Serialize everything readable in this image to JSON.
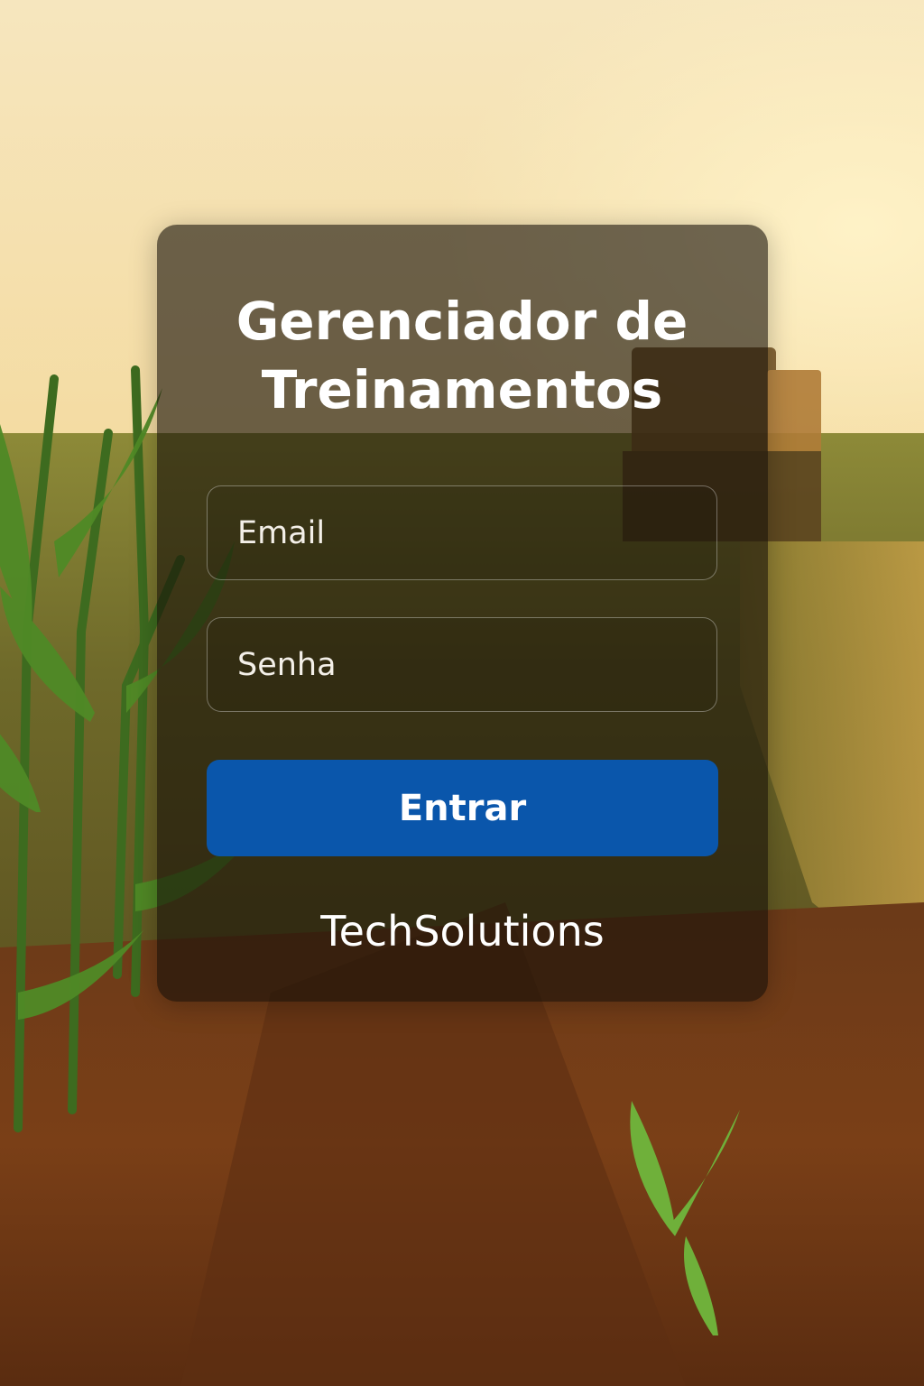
{
  "login": {
    "title_line1": "Gerenciador de",
    "title_line2": "Treinamentos",
    "email_placeholder": "Email",
    "password_placeholder": "Senha",
    "submit_label": "Entrar",
    "brand": "TechSolutions"
  },
  "colors": {
    "button": "#0a56ab",
    "card_overlay": "rgba(22,16,8,0.62)",
    "text": "#ffffff"
  }
}
